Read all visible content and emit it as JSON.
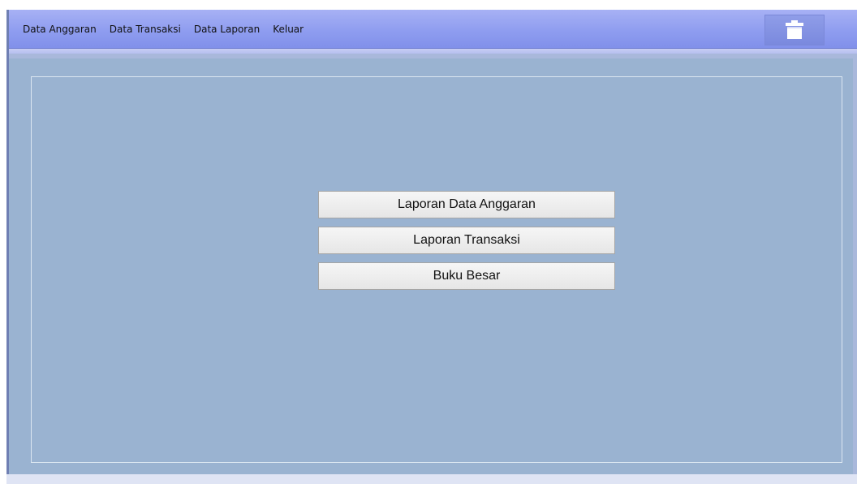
{
  "menubar": {
    "items": [
      {
        "label": "Data Anggaran"
      },
      {
        "label": "Data Transaksi"
      },
      {
        "label": "Data Laporan"
      },
      {
        "label": "Keluar"
      }
    ],
    "logo_icon": "pot-icon"
  },
  "main": {
    "buttons": [
      {
        "label": "Laporan Data Anggaran"
      },
      {
        "label": "Laporan Transaksi"
      },
      {
        "label": "Buku Besar"
      }
    ]
  },
  "colors": {
    "menubar": "#8f9df0",
    "content_background": "#9ab3d1",
    "button_face": "#ececec"
  }
}
